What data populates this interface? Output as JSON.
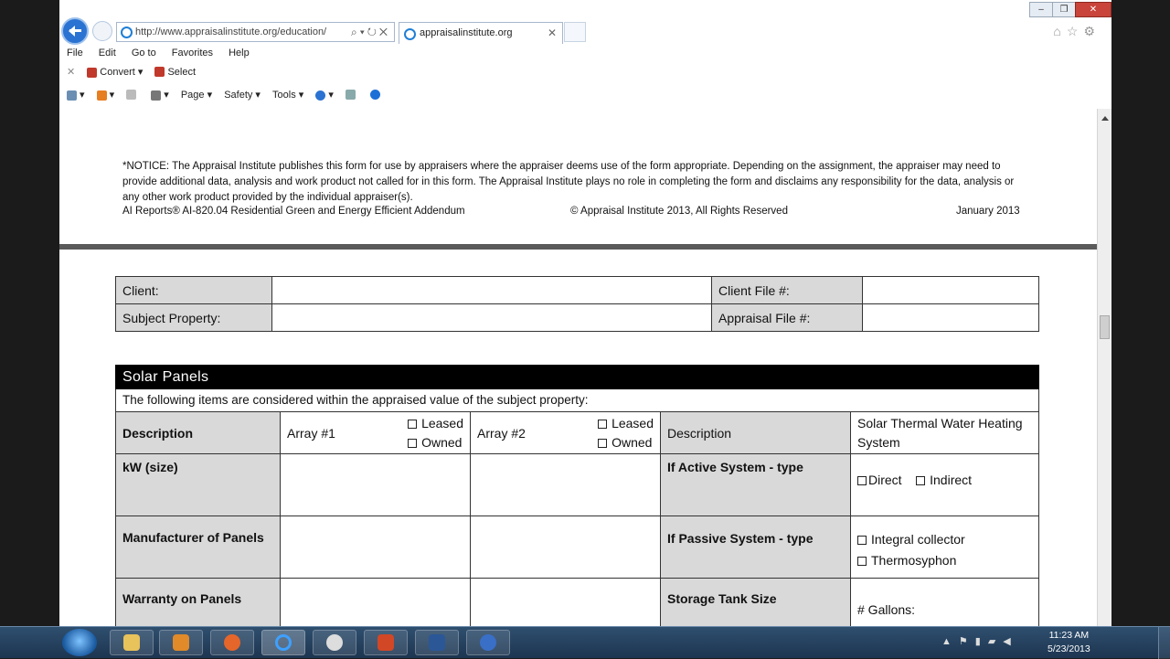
{
  "browser": {
    "url": "http://www.appraisalinstitute.org/education/",
    "tab_title": "appraisalinstitute.org",
    "menu": [
      "File",
      "Edit",
      "Go to",
      "Favorites",
      "Help"
    ],
    "convert_label": "Convert",
    "select_label": "Select",
    "toolbar": {
      "page": "Page",
      "safety": "Safety",
      "tools": "Tools"
    }
  },
  "document": {
    "notice": "*NOTICE: The Appraisal Institute publishes this form for use by appraisers where the appraiser deems use of the form appropriate. Depending on the assignment, the appraiser may need to provide additional data, analysis and work product not called for in this form. The Appraisal Institute plays no role in completing the form and disclaims any responsibility for the data, analysis or any other work product provided by the individual appraiser(s).",
    "footer_left": "AI Reports® AI-820.04 Residential Green and Energy Efficient Addendum",
    "footer_center": "© Appraisal Institute 2013, All Rights Reserved",
    "footer_right": "January 2013",
    "client_label": "Client:",
    "subject_label": "Subject Property:",
    "client_file_label": "Client File #:",
    "appraisal_file_label": "Appraisal File #:",
    "solar_title": "Solar  Panels",
    "solar_sub": "The following items are considered within the appraised value of the subject property:",
    "description": "Description",
    "array1": "Array #1",
    "array2": "Array #2",
    "leased": "Leased",
    "owned": "Owned",
    "description2": "Description",
    "solar_thermal": "Solar Thermal Water Heating System",
    "kw_size": "kW (size)",
    "active_type": "If Active System - type",
    "direct": "Direct",
    "indirect": "Indirect",
    "manufacturer": "Manufacturer of Panels",
    "passive_type": "If Passive System - type",
    "integral": "Integral collector",
    "thermosyphon": "Thermosyphon",
    "warranty": "Warranty on Panels",
    "storage": "Storage Tank Size",
    "gallons": "# Gallons:"
  },
  "taskbar": {
    "time": "11:23 AM",
    "date": "5/23/2013"
  }
}
